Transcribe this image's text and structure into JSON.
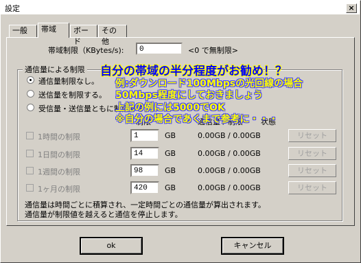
{
  "window": {
    "title": "設定",
    "close_glyph": "×"
  },
  "tabs": [
    {
      "label": "一般"
    },
    {
      "label": "帯域"
    },
    {
      "label": "ボード"
    },
    {
      "label": "その他"
    }
  ],
  "bandwidth": {
    "label": "帯域制限（KBytes/s):",
    "value": "0",
    "hint": "<0 で無制限>"
  },
  "group": {
    "label": "通信量による制限",
    "radios": [
      {
        "label": "通信量制限なし。",
        "checked": true
      },
      {
        "label": "送信量を制限する。",
        "checked": false
      },
      {
        "label": "受信量・送信量ともに制限する。",
        "checked": false
      }
    ],
    "col_limit": "制限",
    "col_usage": "通信量 / 制限",
    "col_state": "状態",
    "rows": [
      {
        "label": "1時間の制限",
        "value": "1",
        "unit": "GB",
        "usage": "0.00GB / 0.00GB",
        "reset": "リセット"
      },
      {
        "label": "1日間の制限",
        "value": "14",
        "unit": "GB",
        "usage": "0.00GB / 0.00GB",
        "reset": "リセット"
      },
      {
        "label": "1週間の制限",
        "value": "98",
        "unit": "GB",
        "usage": "0.00GB / 0.00GB",
        "reset": "リセット"
      },
      {
        "label": "1ヶ月の制限",
        "value": "420",
        "unit": "GB",
        "usage": "0.00GB / 0.00GB",
        "reset": "リセット"
      }
    ],
    "note1": "通信量は時間ごとに積算され、一定時間ごとの通信量が算出されます。",
    "note2": "通信量が制限値を越えると通信を停止します。"
  },
  "buttons": {
    "ok": "ok",
    "cancel": "キャンセル"
  },
  "annotation": {
    "line1": "自分の帯域の半分程度がお勧め！？",
    "line2": "例:ダウンロード100Mbpsの光回線の場合",
    "line3": "50Mbps程度にしておきましょう",
    "line4": "上記の例には5000でOK",
    "line5": "※自分の場合であくまで参考に・・・"
  }
}
